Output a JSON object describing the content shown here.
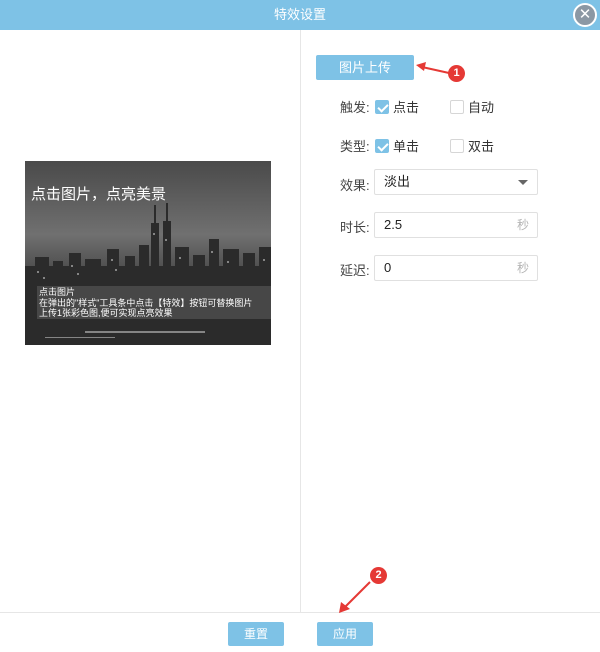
{
  "dialog": {
    "title": "特效设置",
    "close_icon": "close-icon",
    "close_glyph": "✕"
  },
  "preview": {
    "headline": "点击图片，点亮美景",
    "tip_lines": [
      "点击图片",
      "在弹出的\"样式\"工具条中点击【特效】按钮可替换图片",
      "上传1张彩色图,便可实现点亮效果"
    ]
  },
  "settings": {
    "upload_label": "图片上传",
    "trigger": {
      "label": "触发:",
      "options": [
        {
          "label": "点击",
          "checked": true
        },
        {
          "label": "自动",
          "checked": false
        }
      ]
    },
    "type": {
      "label": "类型:",
      "options": [
        {
          "label": "单击",
          "checked": true
        },
        {
          "label": "双击",
          "checked": false
        }
      ]
    },
    "effect": {
      "label": "效果:",
      "value": "淡出"
    },
    "duration": {
      "label": "时长:",
      "value": "2.5",
      "unit": "秒"
    },
    "delay": {
      "label": "延迟:",
      "value": "0",
      "unit": "秒"
    }
  },
  "footer": {
    "reset_label": "重置",
    "apply_label": "应用"
  },
  "annotations": {
    "badge1": "1",
    "badge2": "2"
  },
  "colors": {
    "accent": "#7ec2e6",
    "annotation": "#e53935"
  }
}
